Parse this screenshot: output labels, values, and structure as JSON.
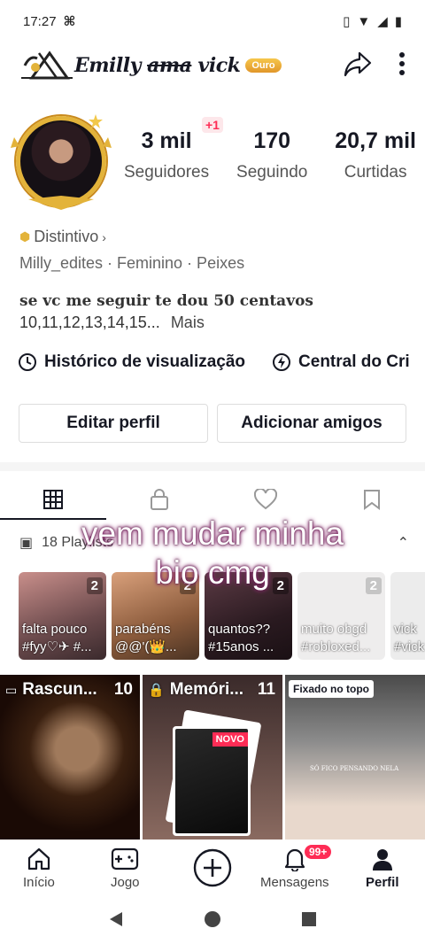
{
  "status": {
    "time": "17:27"
  },
  "header": {
    "username_part1": "Emilly",
    "username_strike": "ama",
    "username_part2": "vick",
    "tier_badge": "Ouro"
  },
  "stats": [
    {
      "value": "3 mil",
      "label": "Seguidores"
    },
    {
      "value": "170",
      "label": "Seguindo"
    },
    {
      "value": "20,7 mil",
      "label": "Curtidas"
    }
  ],
  "followers_delta": "+1",
  "distintivo": "Distintivo",
  "meta": "Milly_edites · Feminino · Peixes",
  "bio": {
    "line1": "se vc me seguir te dou 50 centavos",
    "line2": "10,11,12,13,14,15...",
    "more": "Mais"
  },
  "shortcuts": {
    "history": "Histórico de visualização",
    "creator_center": "Central do Cri"
  },
  "buttons": {
    "edit": "Editar perfil",
    "add_friends": "Adicionar amigos"
  },
  "playlists": {
    "header": "18 Playlists",
    "items": [
      {
        "count": "2",
        "title": "falta pouco",
        "tag": "#fyy♡✈ #..."
      },
      {
        "count": "2",
        "title": "parabéns",
        "tag": "@@'(👑..."
      },
      {
        "count": "2",
        "title": "quantos??",
        "tag": "#15anos ..."
      },
      {
        "count": "2",
        "title": "muito obgd",
        "tag": "#robloxed..."
      },
      {
        "count": "",
        "title": "vick",
        "tag": "#vick"
      }
    ]
  },
  "overlay": {
    "line1": "vem mudar minha",
    "line2": "bio cmg"
  },
  "grid": {
    "drafts": {
      "label": "Rascun...",
      "count": "10"
    },
    "memories": {
      "label": "Memóri...",
      "count": "11",
      "new_badge": "NOVO"
    },
    "pinned": {
      "label": "Fixado no topo",
      "caption": "SÓ FICO PENSANDO NELA"
    }
  },
  "bottom_nav": {
    "home": "Início",
    "games": "Jogo",
    "messages": "Mensagens",
    "messages_badge": "99+",
    "profile": "Perfil"
  },
  "colors": {
    "accent": "#fe2c55",
    "gold": "#e3b33a"
  }
}
